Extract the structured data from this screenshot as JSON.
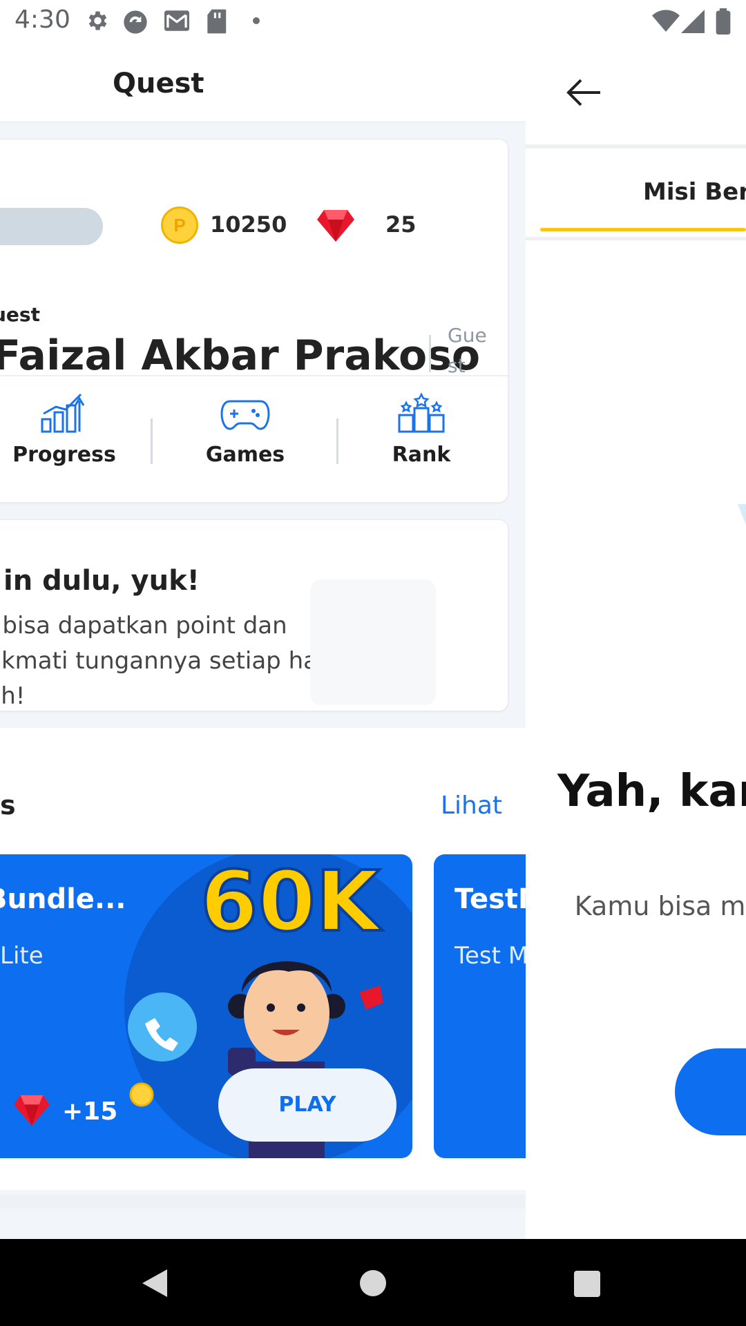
{
  "status_bar": {
    "time": "4:30"
  },
  "quest_panel": {
    "title": "Quest",
    "stats": {
      "points": "10250",
      "gems": "25"
    },
    "profile": {
      "role": "uest",
      "name": "Faizal Akbar Prakoso",
      "badge": "Guest"
    },
    "menu": [
      {
        "label": "Progress",
        "icon": "progress-chart-icon"
      },
      {
        "label": "Games",
        "icon": "gamepad-icon"
      },
      {
        "label": "Rank",
        "icon": "podium-icon"
      }
    ],
    "login_banner": {
      "title": "in dulu, yuk!",
      "description": "u bisa dapatkan point dan nikmati tungannya setiap hari, loh!"
    },
    "games_section": {
      "title": "s",
      "see_all": "Lihat",
      "games": [
        {
          "title": "Bundle...",
          "subtitle": "Lite",
          "reward": "+15",
          "play_label": "PLAY",
          "banner_text": "60K"
        },
        {
          "title": "TestM",
          "subtitle": "Test M"
        }
      ]
    }
  },
  "mission_panel": {
    "tab": "Misi Berj",
    "empty_title": "Yah, kan",
    "empty_description": "Kamu bisa me menc"
  },
  "colors": {
    "primary": "#0d6ff0",
    "accent": "#f5c518",
    "gem": "#e8172b",
    "coin": "#ffd23c"
  }
}
